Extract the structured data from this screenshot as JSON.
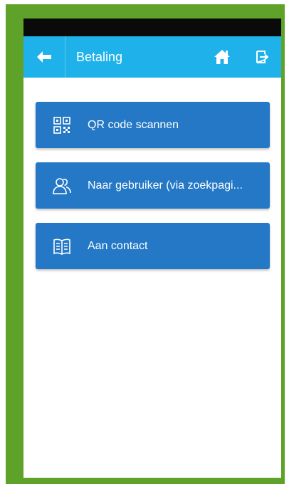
{
  "app": {
    "title": "Betaling",
    "colors": {
      "frame": "#5ea22a",
      "toolbar": "#1fb2ea",
      "button": "#2478c6",
      "statusbar": "#0a0a0a"
    }
  },
  "toolbar": {
    "back_icon": "arrow-left-icon",
    "home_icon": "home-icon",
    "logout_icon": "logout-icon"
  },
  "menu": {
    "items": [
      {
        "label": "QR code scannen",
        "icon": "qr-code-icon"
      },
      {
        "label": "Naar gebruiker (via zoekpagi...",
        "icon": "users-icon"
      },
      {
        "label": "Aan contact",
        "icon": "address-book-icon"
      }
    ]
  }
}
